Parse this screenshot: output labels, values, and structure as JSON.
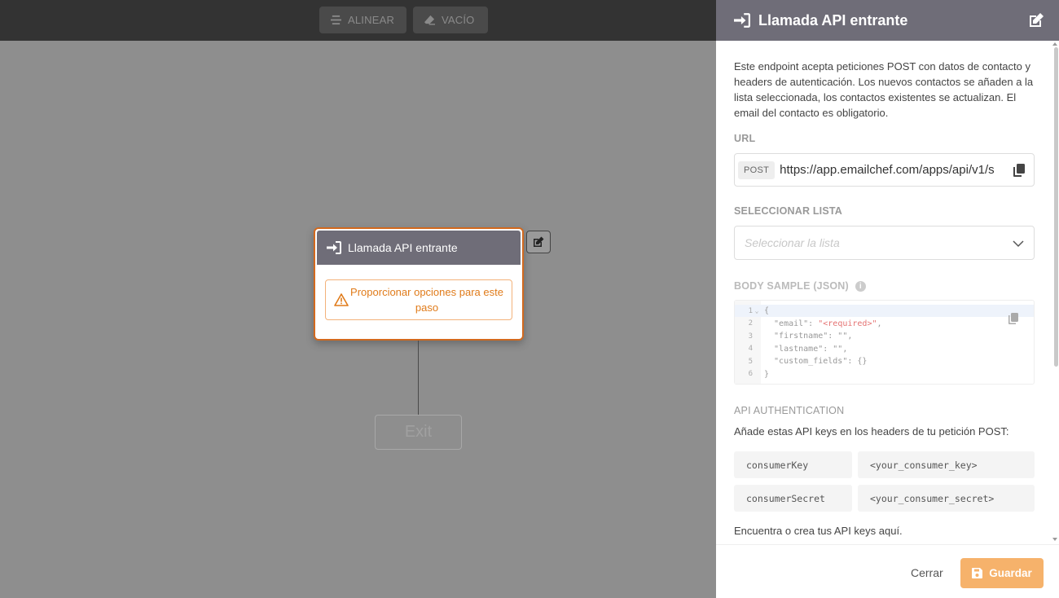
{
  "toolbar": {
    "align_label": "ALINEAR",
    "clear_label": "VACÍO"
  },
  "node": {
    "title": "Llamada API entrante",
    "warning": "Proporcionar opciones para este paso",
    "exit_label": "Exit"
  },
  "panel": {
    "title": "Llamada API entrante",
    "description": "Este endpoint acepta peticiones POST con datos de contacto y headers de autenticación. Los nuevos contactos se añaden a la lista seleccionada, los contactos existentes se actualizan. El email del contacto es obligatorio.",
    "url_label": "URL",
    "method": "POST",
    "url": "https://app.emailchef.com/apps/api/v1/s",
    "list_label": "SELECCIONAR LISTA",
    "list_placeholder": "Seleccionar la lista",
    "body_label": "BODY SAMPLE (JSON)",
    "body_info": "i",
    "code_lines": [
      {
        "n": "1",
        "text": "{"
      },
      {
        "n": "2",
        "text": "  \"email\": ",
        "req": "\"<required>\"",
        "tail": ","
      },
      {
        "n": "3",
        "text": "  \"firstname\": \"\","
      },
      {
        "n": "4",
        "text": "  \"lastname\": \"\","
      },
      {
        "n": "5",
        "text": "  \"custom_fields\": {}"
      },
      {
        "n": "6",
        "text": "}"
      }
    ],
    "auth_label": "API AUTHENTICATION",
    "auth_desc": "Añade estas API keys en los headers de tu petición POST:",
    "keys": [
      {
        "name": "consumerKey",
        "value": "<your_consumer_key>"
      },
      {
        "name": "consumerSecret",
        "value": "<your_consumer_secret>"
      }
    ],
    "find_keys": "Encuentra o crea tus API keys aquí.",
    "close_label": "Cerrar",
    "save_label": "Guardar"
  },
  "colors": {
    "header": "#6f6d78",
    "accent_orange": "#d2691e",
    "save_button": "#f6b26b"
  }
}
